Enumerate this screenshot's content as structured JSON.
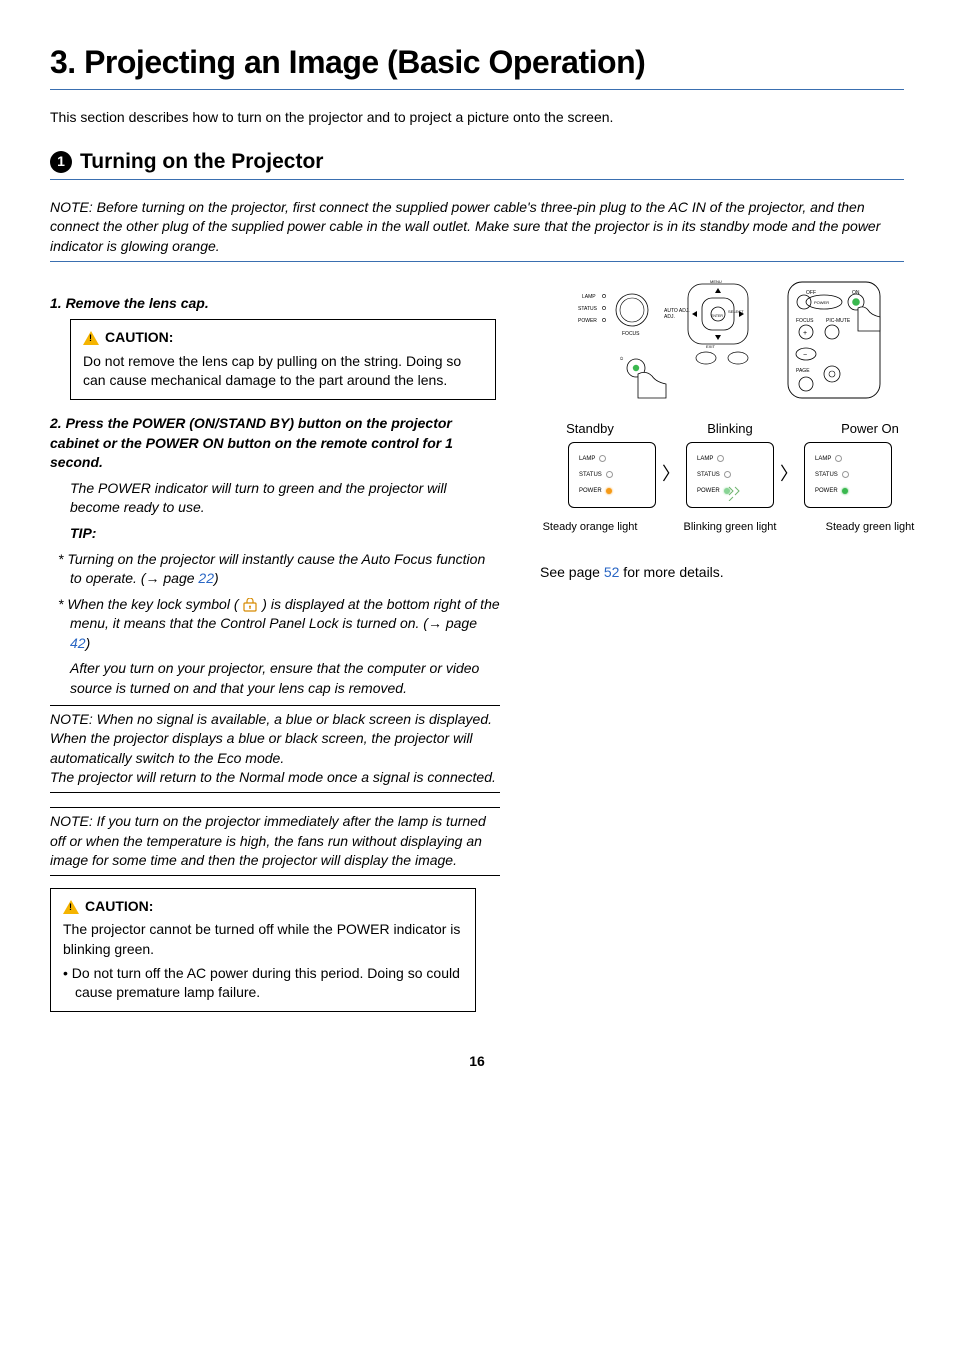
{
  "chapter_title": "3. Projecting an Image (Basic Operation)",
  "intro": "This section describes how to turn on the projector and to project a picture onto the screen.",
  "section": {
    "number": "1",
    "title": "Turning on the Projector"
  },
  "note_top": "NOTE: Before turning on the projector, first connect the supplied power cable's three-pin plug to the AC IN of the projector, and then connect the other plug of the supplied power cable in the wall outlet. Make sure that the projector is in its standby mode and the power indicator is glowing orange.",
  "step1": "1.  Remove the lens cap.",
  "caution1": {
    "header": "CAUTION:",
    "body": "Do not remove the lens cap by pulling on the string. Doing so can cause mechanical damage to the part around the lens."
  },
  "step2": "2.  Press the POWER (ON/STAND BY) button on the projector cabinet or the POWER ON button on the remote control for 1 second.",
  "step2_body": "The POWER indicator will turn to green and the projector will become ready to use.",
  "tip_label": "TIP:",
  "tip1_pre": "*  Turning on the projector will instantly cause the Auto Focus function to operate. (→ page ",
  "tip1_link": "22",
  "tip1_post": ")",
  "tip2_pre": "*  When the key lock symbol ( ",
  "tip2_mid": " ) is displayed at the bottom right of the menu, it means that the Control Panel Lock is turned on. (→ page ",
  "tip2_link": "42",
  "tip2_post": ")",
  "after_text": "After you turn on your projector, ensure that the computer or video source is turned on and that your lens cap is removed.",
  "note_noSignal": "NOTE: When no signal is available, a blue or black screen is displayed.\nWhen the projector displays a blue or black screen, the projector will automatically switch to the Eco mode.\nThe projector will return to the Normal mode once a signal is connected.",
  "note_fans": "NOTE: If you turn on the projector immediately after the lamp is turned off or when the temperature is high, the fans run without displaying an image for some time and then the projector will display the image.",
  "caution2": {
    "header": "CAUTION:",
    "line1": "The projector cannot be turned off while the POWER indicator is blinking green.",
    "bullet": "•  Do not turn off the AC power during this period. Doing so could cause premature lamp failure."
  },
  "panel_labels": {
    "lamp": "LAMP",
    "status": "STATUS",
    "power": "POWER",
    "auto_adj": "AUTO ADJ.",
    "select": "SELECT",
    "focus": "FOCUS",
    "enter": "ENTER",
    "off": "OFF",
    "on": "ON",
    "pic_mute": "PIC-MUTE",
    "page": "PAGE"
  },
  "states": {
    "standby": "Standby",
    "blinking": "Blinking",
    "poweron": "Power On",
    "standby_sub": "Steady orange light",
    "blinking_sub": "Blinking green light",
    "poweron_sub": "Steady green light"
  },
  "see_page_pre": "See page ",
  "see_page_link": "52",
  "see_page_post": " for more details.",
  "page_number": "16"
}
